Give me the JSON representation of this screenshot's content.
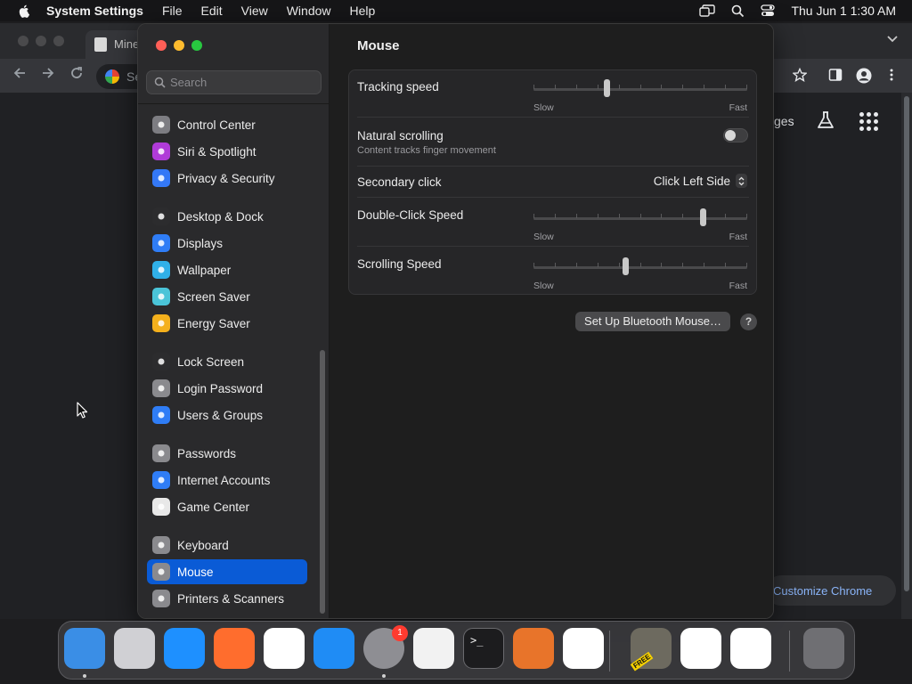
{
  "menubar": {
    "app_name": "System Settings",
    "menus": [
      "File",
      "Edit",
      "View",
      "Window",
      "Help"
    ],
    "clock": "Thu Jun 1  1:30 AM"
  },
  "chrome": {
    "tab_title": "Mine",
    "omnibox_text": "Se",
    "ntp_link": "ges",
    "customize_label": "Customize Chrome"
  },
  "settings": {
    "search_placeholder": "Search",
    "sidebar": [
      {
        "label": "Control Center",
        "icon": "control-center-icon",
        "color": "#7d7d82"
      },
      {
        "label": "Siri & Spotlight",
        "icon": "siri-icon",
        "color": "#b03bd8"
      },
      {
        "label": "Privacy & Security",
        "icon": "hand-icon",
        "color": "#3478f6"
      },
      {
        "label": "Desktop & Dock",
        "icon": "dock-icon",
        "color": "#2c2c2e"
      },
      {
        "label": "Displays",
        "icon": "sun-icon",
        "color": "#2f7df6"
      },
      {
        "label": "Wallpaper",
        "icon": "flower-icon",
        "color": "#30b0e8"
      },
      {
        "label": "Screen Saver",
        "icon": "screen-saver-icon",
        "color": "#4ac4d8"
      },
      {
        "label": "Energy Saver",
        "icon": "bulb-icon",
        "color": "#f4b01c"
      },
      {
        "label": "Lock Screen",
        "icon": "lock-icon",
        "color": "#2c2c2e"
      },
      {
        "label": "Login Password",
        "icon": "padlock-icon",
        "color": "#8a8a8e"
      },
      {
        "label": "Users & Groups",
        "icon": "users-icon",
        "color": "#2f7df6"
      },
      {
        "label": "Passwords",
        "icon": "key-icon",
        "color": "#8a8a8e"
      },
      {
        "label": "Internet Accounts",
        "icon": "at-icon",
        "color": "#2f7df6"
      },
      {
        "label": "Game Center",
        "icon": "game-center-icon",
        "color": "#e8e8e8"
      },
      {
        "label": "Keyboard",
        "icon": "keyboard-icon",
        "color": "#8a8a8e"
      },
      {
        "label": "Mouse",
        "icon": "mouse-icon",
        "color": "#8a8a8e"
      },
      {
        "label": "Printers & Scanners",
        "icon": "printer-icon",
        "color": "#8a8a8e"
      }
    ],
    "active_item": "Mouse",
    "page_title": "Mouse",
    "tracking": {
      "label": "Tracking speed",
      "min": "Slow",
      "max": "Fast",
      "value": 0.34
    },
    "natural": {
      "label": "Natural scrolling",
      "sub": "Content tracks finger movement",
      "on": false
    },
    "secondary": {
      "label": "Secondary click",
      "value": "Click Left Side"
    },
    "double_click": {
      "label": "Double-Click Speed",
      "min": "Slow",
      "max": "Fast",
      "value": 0.79
    },
    "scrolling": {
      "label": "Scrolling Speed",
      "min": "Slow",
      "max": "Fast",
      "value": 0.43
    },
    "bluetooth_button": "Set Up Bluetooth Mouse…",
    "help_label": "?"
  },
  "dock": {
    "apps": [
      {
        "name": "finder-icon",
        "color": "#3a8ee6"
      },
      {
        "name": "launchpad-icon",
        "color": "#d0d0d4"
      },
      {
        "name": "safari-icon",
        "color": "#1e90ff"
      },
      {
        "name": "firefox-icon",
        "color": "#ff6d2d"
      },
      {
        "name": "chrome-icon",
        "color": "#ffffff"
      },
      {
        "name": "app-store-icon",
        "color": "#1f8cf5"
      },
      {
        "name": "system-settings-icon",
        "color": "#8e8e93"
      },
      {
        "name": "textedit-icon",
        "color": "#f2f2f2"
      },
      {
        "name": "terminal-icon",
        "color": "#1c1c1e"
      },
      {
        "name": "garageband-icon",
        "color": "#e8742a"
      },
      {
        "name": "vscode-icon",
        "color": "#ffffff"
      },
      {
        "name": "statue-app-icon",
        "color": "#6d6a5f"
      },
      {
        "name": "remote-desktop-icon",
        "color": "#ffffff"
      },
      {
        "name": "powerpoint-icon",
        "color": "#ffffff"
      },
      {
        "name": "trash-icon",
        "color": "#6f6f73"
      }
    ],
    "settings_badge": "1",
    "free_badge": "FREE"
  }
}
